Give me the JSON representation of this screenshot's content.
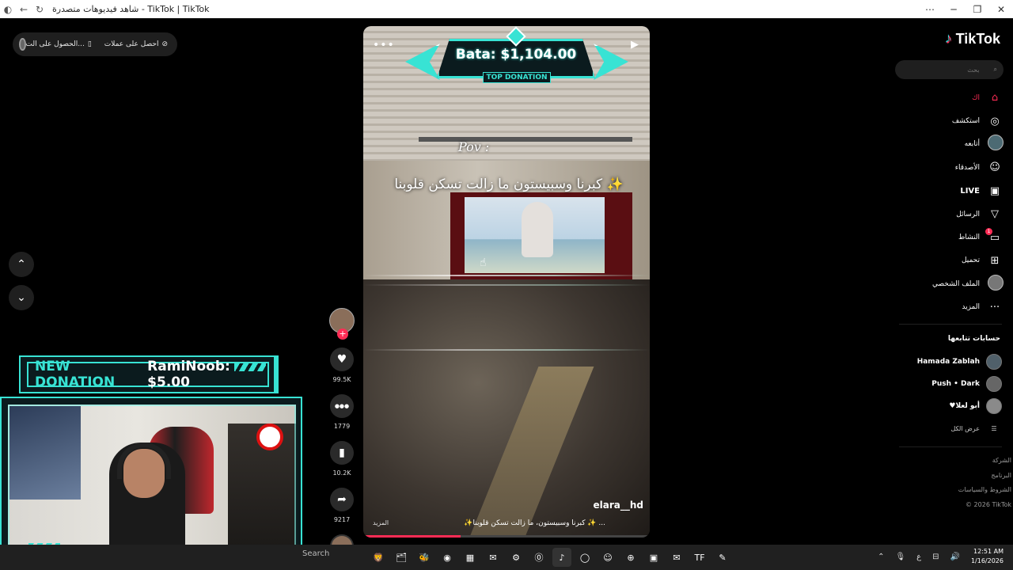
{
  "window": {
    "title": "شاهد فيديوهات متصدرة - TikTok | TikTok",
    "controls": {
      "menu": "⋯",
      "minimize": "─",
      "restore": "❐",
      "close": "✕"
    }
  },
  "top_pill": {
    "items": [
      {
        "icon": "⊘",
        "label": "احصل على عملات"
      },
      {
        "icon": "▯",
        "label": "الحصول على الت..."
      }
    ]
  },
  "nav_arrows": {
    "up": "⌃",
    "down": "⌄"
  },
  "video": {
    "overlay_top_donation": {
      "amount": "Bata: $1,104.00",
      "badge": "TOP DONATION"
    },
    "pov": "Pov :",
    "caption": "كبرنا وسبيستون ما زالت تسكن قلوبنا ✨",
    "username": "elara__hd",
    "description": "✨كبرنا وسبيستون، ما زالت تسكن قلوبنا ✨ ...",
    "more_label": "المزيد",
    "progress": 0.34
  },
  "actions": {
    "follow_plus": "+",
    "likes": {
      "icon": "♥",
      "count": "99.5K"
    },
    "comments": {
      "icon": "●●●",
      "count": "1779"
    },
    "saves": {
      "icon": "▮",
      "count": "10.2K"
    },
    "shares": {
      "icon": "➦",
      "count": "9217"
    }
  },
  "sidebar": {
    "logo": "TikTok",
    "search_placeholder": "بحث",
    "nav": [
      {
        "label": "اك",
        "icon": "⌂",
        "active": true
      },
      {
        "label": "استكشف",
        "icon": "◎",
        "active": false
      },
      {
        "label": "أتابعه",
        "icon": "avatar",
        "active": false
      },
      {
        "label": "الأصدقاء",
        "icon": "☺",
        "active": false
      },
      {
        "label": "LIVE",
        "icon": "▣",
        "active": false
      },
      {
        "label": "الرسائل",
        "icon": "▽",
        "active": false
      },
      {
        "label": "النشاط",
        "icon": "▭",
        "active": false,
        "badge": "1"
      },
      {
        "label": "تحميل",
        "icon": "⊞",
        "active": false
      },
      {
        "label": "الملف الشخصي",
        "icon": "avatar",
        "active": false
      },
      {
        "label": "المزيد",
        "icon": "···",
        "active": false
      }
    ],
    "following_title": "حسابات تتابعها",
    "following": [
      {
        "name": "Hamada Zablah"
      },
      {
        "name": "Push • Dark"
      },
      {
        "name": "♥أبو لعلا"
      }
    ],
    "see_all": "عرض الكل",
    "footer": [
      "الشركة",
      "البرنامج",
      "الشروط والسياسات",
      "© 2026 TikTok"
    ]
  },
  "stream_overlay": {
    "new_donation_label": "NEW DONATION",
    "new_donation_text": "RamiNoob: $5.00"
  },
  "taskbar": {
    "search": "Search",
    "icons": [
      "🦁",
      "🗂",
      "🐝",
      "◉",
      "▦",
      "✉",
      "⚙",
      "⓪",
      "♪",
      "◯",
      "☺",
      "⊕",
      "▣",
      "✉",
      "TF",
      "✎"
    ],
    "tray": {
      "chevron": "⌃",
      "mic": "🎙",
      "lang": "ع",
      "net": "⊟",
      "vol": "🔊",
      "time": "12:51 AM",
      "date": "1/16/2026"
    }
  },
  "colors": {
    "accent": "#fe2c55",
    "overlay_cyan": "#38e3d4",
    "background": "#000000"
  }
}
